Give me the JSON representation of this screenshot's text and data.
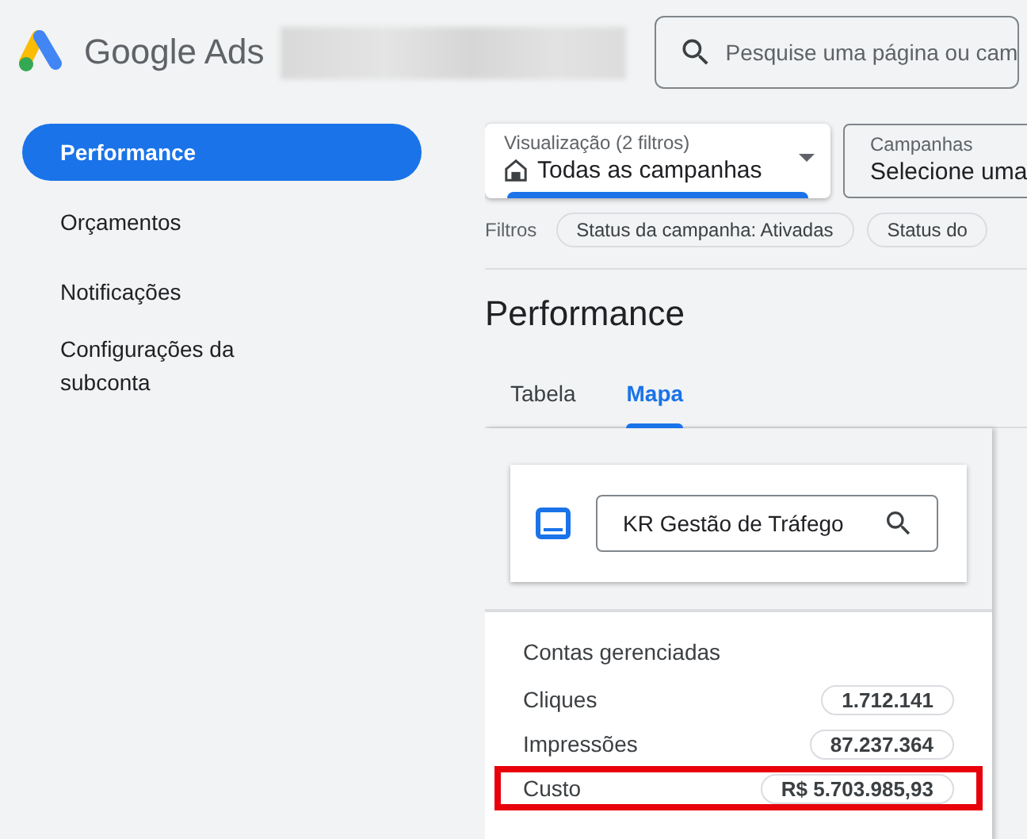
{
  "header": {
    "product": "Google Ads",
    "search": {
      "placeholder": "Pesquise uma página ou cam"
    }
  },
  "sidebar": {
    "items": [
      {
        "label": "Performance",
        "selected": true
      },
      {
        "label": "Orçamentos",
        "selected": false
      },
      {
        "label": "Notificações",
        "selected": false
      },
      {
        "label": "Configurações da subconta",
        "selected": false
      }
    ]
  },
  "view_selector": {
    "label": "Visualização (2 filtros)",
    "value": "Todas as campanhas"
  },
  "campaign_selector": {
    "label": "Campanhas",
    "value": "Selecione uma"
  },
  "filters": {
    "label": "Filtros",
    "chips": [
      "Status da campanha: Ativadas",
      "Status do"
    ]
  },
  "page_title": "Performance",
  "tabs": [
    {
      "label": "Tabela",
      "selected": false
    },
    {
      "label": "Mapa",
      "selected": true
    }
  ],
  "map_panel": {
    "account_search": {
      "value": "KR Gestão de Tráfego"
    },
    "section_title": "Contas gerenciadas",
    "metrics": [
      {
        "label": "Cliques",
        "value": "1.712.141",
        "highlighted": false
      },
      {
        "label": "Impressões",
        "value": "87.237.364",
        "highlighted": false
      },
      {
        "label": "Custo",
        "value": "R$ 5.703.985,93",
        "highlighted": true
      }
    ]
  }
}
